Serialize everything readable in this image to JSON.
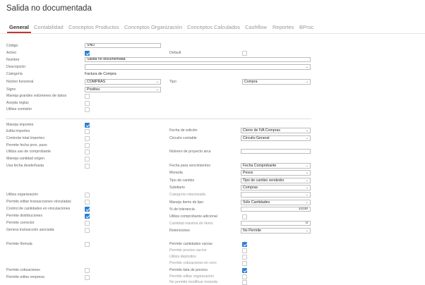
{
  "header": {
    "title": "Salida no documentada"
  },
  "tabs": [
    "General",
    "Contabilidad",
    "Conceptos Productos",
    "Conceptos Organización",
    "Conceptos Calculados",
    "Cashflow",
    "Reportes",
    "BProc"
  ],
  "form": {
    "codigo_label": "Código",
    "codigo_value": "SND",
    "activo_label": "Activo",
    "default_label": "Default",
    "nombre_label": "Nombre",
    "nombre_value": "Salida no documentada",
    "descripcion_label": "Descripción",
    "categoria_label": "Categoría",
    "categoria_value": "Factura de Compra",
    "nucleo_label": "Núcleo funcional",
    "nucleo_value": "COMPRAS",
    "tipo_label": "Tipo",
    "tipo_value": "Compra",
    "signo_label": "Signo",
    "signo_value": "Positivo.",
    "maneja_grandes_label": "Maneja grandes volúmenes de datos",
    "acepta_reglas_label": "Acepta reglas",
    "utiliza_comision_label": "Utiliza comisión",
    "maneja_importes_label": "Maneja importes",
    "edita_importes_label": "Edita importes",
    "controlar_total_label": "Controlar total importes",
    "permite_fecha_label": "Permite fecha prox. paso",
    "utiliza_uso_label": "Utiliza uso de comprobante",
    "maneja_cantidad_label": "Maneja cantidad origen",
    "usa_fecha_desde_label": "Usa fecha desde/hasta",
    "fecha_edicion_label": "Fecha de edición",
    "fecha_edicion_value": "Cierre de IVA Compras",
    "circuito_label": "Circuito contable",
    "circuito_value": "Circuito General",
    "numero_proyecto_label": "Número de proyecto arca",
    "fecha_venc_label": "Fecha para vencimientos",
    "fecha_venc_value": "Fecha Comprobante",
    "moneda_label": "Moneda",
    "moneda_value": "Pesos",
    "tipo_cambio_label": "Tipo de cambio",
    "tipo_cambio_value": "Tipo de cambio vendedor",
    "subdiario_label": "Subdiario",
    "subdiario_value": "Compras",
    "utiliza_org_label": "Utiliza organización",
    "permite_editar_trans_label": "Permite editar transacciones vinculadas",
    "control_cantidades_label": "Control de cantidades en vinculaciones",
    "permite_distribuciones_label": "Permite distribuciones",
    "permite_corrector_label": "Permite corrector",
    "genera_trans_label": "Genera transacción asociada",
    "categoria_rel_label": "Categoría relacionada",
    "maneja_items_label": "Maneja ítems de tipo",
    "maneja_items_value": "Sólo Cantidades",
    "tolerancia_label": "% de tolerancia",
    "tolerancia_value": "10,00",
    "utiliza_comp_adic_label": "Utiliza comprobante adicional",
    "cantidad_max_label": "Cantidad máxima de ítems",
    "cantidad_max_value": "0",
    "retenciones_label": "Retenciones",
    "retenciones_value": "No Permite",
    "permite_formula_label": "Permite fórmula",
    "permite_cant_vacias_label": "Permite cantidades vacías",
    "permite_precios_vacios_label": "Permite precios vacíos",
    "utiliza_depositos_label": "Utiliza depósitos",
    "permite_cotiz_cero_label": "Permite cotizaciones en cero",
    "permite_cotizaciones_label": "Permite cotizaciones",
    "permite_lista_precios_label": "Permite lista de precios",
    "permite_editar_empresa_label": "Permite editar empresa",
    "permite_editar_org_label": "Permite editar organización",
    "no_permite_modificar_moneda_label": "No permite modificar moneda"
  },
  "colors": {
    "accent": "#c0392b",
    "checkbox": "#2a7fd4"
  }
}
